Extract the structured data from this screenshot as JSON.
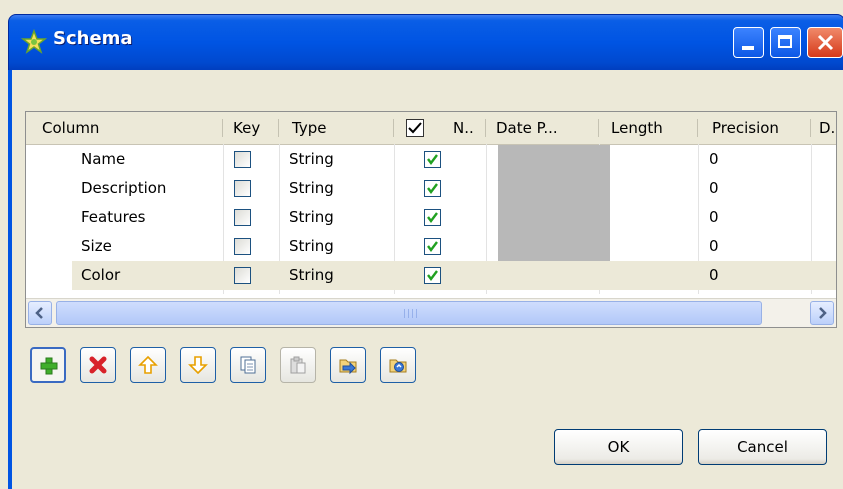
{
  "window": {
    "title": "Schema"
  },
  "table": {
    "columns": [
      "Column",
      "Key",
      "Type",
      "N..",
      "Date P...",
      "Length",
      "Precision",
      "D."
    ],
    "rows": [
      {
        "name": "Name",
        "type": "String",
        "precision": "0"
      },
      {
        "name": "Description",
        "type": "String",
        "precision": "0"
      },
      {
        "name": "Features",
        "type": "String",
        "precision": "0"
      },
      {
        "name": "Size",
        "type": "String",
        "precision": "0"
      },
      {
        "name": "Color",
        "type": "String",
        "precision": "0"
      }
    ],
    "selected_row": "Color"
  },
  "toolbar": {
    "icons": [
      "add-icon",
      "remove-icon",
      "move-up-icon",
      "move-down-icon",
      "copy-icon",
      "paste-icon",
      "import-icon",
      "export-icon"
    ]
  },
  "buttons": {
    "ok": "OK",
    "cancel": "Cancel"
  },
  "colors": {
    "title_bar": "#0054e3",
    "dialog_bg": "#ece9d8",
    "check_green": "#21a121"
  }
}
